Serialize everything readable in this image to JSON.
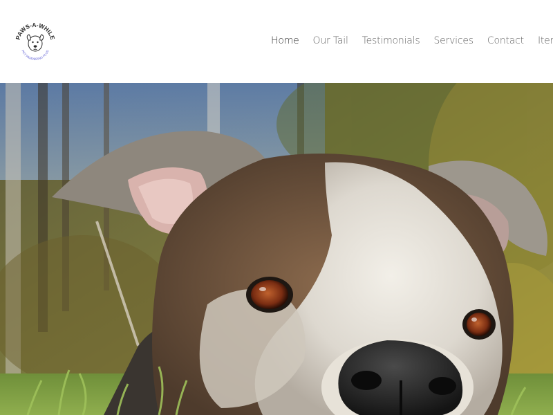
{
  "brand": {
    "logo_text_top": "PAWS-A-WHILE",
    "logo_text_bottom": "PET PAMPERING PLUS"
  },
  "nav": {
    "items": [
      {
        "label": "Home",
        "active": true
      },
      {
        "label": "Our Tail",
        "active": false
      },
      {
        "label": "Testimonials",
        "active": false
      },
      {
        "label": "Services",
        "active": false
      },
      {
        "label": "Contact",
        "active": false
      },
      {
        "label": "Items",
        "active": false
      }
    ]
  },
  "colors": {
    "nav_text": "#666666",
    "nav_active": "#333333",
    "logo_ink": "#2a2a2a",
    "logo_accent": "#6a6ad8"
  }
}
